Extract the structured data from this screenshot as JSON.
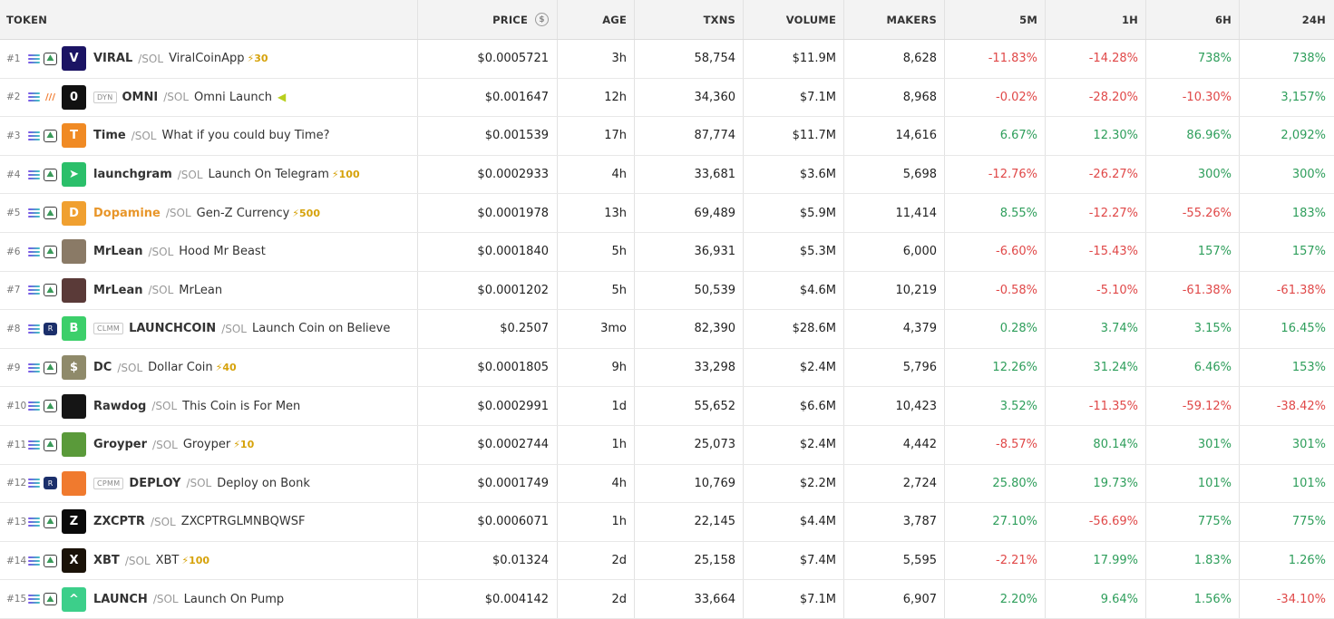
{
  "headers": {
    "token": "TOKEN",
    "price": "PRICE",
    "age": "AGE",
    "txns": "TXNS",
    "volume": "VOLUME",
    "makers": "MAKERS",
    "m5": "5M",
    "h1": "1H",
    "h6": "6H",
    "h24": "24H"
  },
  "price_icon": "$",
  "colors": {
    "positive": "#2e9e5b",
    "negative": "#e04848",
    "boost": "#d6a20a",
    "dopamine": "#f0a030"
  },
  "rows": [
    {
      "rank": "#1",
      "dex": "pump",
      "logo_icon": "viral-v-icon",
      "logo_color": "#1b1464",
      "logo_glyph": "V",
      "badge": "",
      "symbol": "VIRAL",
      "quote": "/SOL",
      "name": "ViralCoinApp",
      "boost": "⚡30",
      "flag": false,
      "price": "$0.0005721",
      "age": "3h",
      "txns": "58,754",
      "volume": "$11.9M",
      "makers": "8,628",
      "m5": "-11.83%",
      "h1": "-14.28%",
      "h6": "738%",
      "h24": "738%"
    },
    {
      "rank": "#2",
      "dex": "orange",
      "logo_icon": "omni-zero-icon",
      "logo_color": "#111111",
      "logo_glyph": "0",
      "badge": "DYN",
      "symbol": "OMNI",
      "quote": "/SOL",
      "name": "Omni Launch",
      "boost": "",
      "flag": true,
      "price": "$0.001647",
      "age": "12h",
      "txns": "34,360",
      "volume": "$7.1M",
      "makers": "8,968",
      "m5": "-0.02%",
      "h1": "-28.20%",
      "h6": "-10.30%",
      "h24": "3,157%"
    },
    {
      "rank": "#3",
      "dex": "pump",
      "logo_icon": "time-coin-icon",
      "logo_color": "#f08a24",
      "logo_glyph": "T",
      "badge": "",
      "symbol": "Time",
      "quote": "/SOL",
      "name": "What if you could buy Time?",
      "boost": "",
      "flag": false,
      "price": "$0.001539",
      "age": "17h",
      "txns": "87,774",
      "volume": "$11.7M",
      "makers": "14,616",
      "m5": "6.67%",
      "h1": "12.30%",
      "h6": "86.96%",
      "h24": "2,092%"
    },
    {
      "rank": "#4",
      "dex": "pump",
      "logo_icon": "telegram-icon",
      "logo_color": "#2bbf6a",
      "logo_glyph": "➤",
      "badge": "",
      "symbol": "launchgram",
      "quote": "/SOL",
      "name": "Launch On Telegram",
      "boost": "⚡100",
      "flag": false,
      "price": "$0.0002933",
      "age": "4h",
      "txns": "33,681",
      "volume": "$3.6M",
      "makers": "5,698",
      "m5": "-12.76%",
      "h1": "-26.27%",
      "h6": "300%",
      "h24": "300%"
    },
    {
      "rank": "#5",
      "dex": "pump",
      "logo_icon": "dopamine-logo-icon",
      "logo_color": "#f0a030",
      "logo_glyph": "D",
      "badge": "",
      "symbol": "Dopamine",
      "quote": "/SOL",
      "name": "Gen-Z Currency",
      "boost": "⚡500",
      "flag": false,
      "price": "$0.0001978",
      "age": "13h",
      "txns": "69,489",
      "volume": "$5.9M",
      "makers": "11,414",
      "m5": "8.55%",
      "h1": "-12.27%",
      "h6": "-55.26%",
      "h24": "183%",
      "symbol_color": "#e8962a"
    },
    {
      "rank": "#6",
      "dex": "pump",
      "logo_icon": "mrlean-photo-icon",
      "logo_color": "#8a7a66",
      "logo_glyph": "",
      "badge": "",
      "symbol": "MrLean",
      "quote": "/SOL",
      "name": "Hood Mr Beast",
      "boost": "",
      "flag": false,
      "price": "$0.0001840",
      "age": "5h",
      "txns": "36,931",
      "volume": "$5.3M",
      "makers": "6,000",
      "m5": "-6.60%",
      "h1": "-15.43%",
      "h6": "157%",
      "h24": "157%"
    },
    {
      "rank": "#7",
      "dex": "pump",
      "logo_icon": "mrlean-photo-icon",
      "logo_color": "#5a3a38",
      "logo_glyph": "",
      "badge": "",
      "symbol": "MrLean",
      "quote": "/SOL",
      "name": "MrLean",
      "boost": "",
      "flag": false,
      "price": "$0.0001202",
      "age": "5h",
      "txns": "50,539",
      "volume": "$4.6M",
      "makers": "10,219",
      "m5": "-0.58%",
      "h1": "-5.10%",
      "h6": "-61.38%",
      "h24": "-61.38%"
    },
    {
      "rank": "#8",
      "dex": "ray",
      "logo_icon": "believe-b-icon",
      "logo_color": "#3ccf6a",
      "logo_glyph": "B",
      "badge": "CLMM",
      "symbol": "LAUNCHCOIN",
      "quote": "/SOL",
      "name": "Launch Coin on Believe",
      "boost": "",
      "flag": false,
      "price": "$0.2507",
      "age": "3mo",
      "txns": "82,390",
      "volume": "$28.6M",
      "makers": "4,379",
      "m5": "0.28%",
      "h1": "3.74%",
      "h6": "3.15%",
      "h24": "16.45%"
    },
    {
      "rank": "#9",
      "dex": "pump",
      "logo_icon": "dollar-coin-icon",
      "logo_color": "#8f8a6a",
      "logo_glyph": "$",
      "badge": "",
      "symbol": "DC",
      "quote": "/SOL",
      "name": "Dollar Coin",
      "boost": "⚡40",
      "flag": false,
      "price": "$0.0001805",
      "age": "9h",
      "txns": "33,298",
      "volume": "$2.4M",
      "makers": "5,796",
      "m5": "12.26%",
      "h1": "31.24%",
      "h6": "6.46%",
      "h24": "153%"
    },
    {
      "rank": "#10",
      "dex": "pump",
      "logo_icon": "rawdog-icon",
      "logo_color": "#151515",
      "logo_glyph": "",
      "badge": "",
      "symbol": "Rawdog",
      "quote": "/SOL",
      "name": "This Coin is For Men",
      "boost": "",
      "flag": false,
      "price": "$0.0002991",
      "age": "1d",
      "txns": "55,652",
      "volume": "$6.6M",
      "makers": "10,423",
      "m5": "3.52%",
      "h1": "-11.35%",
      "h6": "-59.12%",
      "h24": "-38.42%"
    },
    {
      "rank": "#11",
      "dex": "pump",
      "logo_icon": "frog-icon",
      "logo_color": "#5a9a3a",
      "logo_glyph": "",
      "badge": "",
      "symbol": "Groyper",
      "quote": "/SOL",
      "name": "Groyper",
      "boost": "⚡10",
      "flag": false,
      "price": "$0.0002744",
      "age": "1h",
      "txns": "25,073",
      "volume": "$2.4M",
      "makers": "4,442",
      "m5": "-8.57%",
      "h1": "80.14%",
      "h6": "301%",
      "h24": "301%"
    },
    {
      "rank": "#12",
      "dex": "ray",
      "logo_icon": "bonk-dog-icon",
      "logo_color": "#f07a2e",
      "logo_glyph": "",
      "badge": "CPMM",
      "symbol": "DEPLOY",
      "quote": "/SOL",
      "name": "Deploy on Bonk",
      "boost": "",
      "flag": false,
      "price": "$0.0001749",
      "age": "4h",
      "txns": "10,769",
      "volume": "$2.2M",
      "makers": "2,724",
      "m5": "25.80%",
      "h1": "19.73%",
      "h6": "101%",
      "h24": "101%"
    },
    {
      "rank": "#13",
      "dex": "pump",
      "logo_icon": "zxcptr-icon",
      "logo_color": "#0a0a0a",
      "logo_glyph": "Z",
      "badge": "",
      "symbol": "ZXCPTR",
      "quote": "/SOL",
      "name": "ZXCPTRGLMNBQWSF",
      "boost": "",
      "flag": false,
      "price": "$0.0006071",
      "age": "1h",
      "txns": "22,145",
      "volume": "$4.4M",
      "makers": "3,787",
      "m5": "27.10%",
      "h1": "-56.69%",
      "h6": "775%",
      "h24": "775%"
    },
    {
      "rank": "#14",
      "dex": "pump",
      "logo_icon": "xbt-icon",
      "logo_color": "#1a1208",
      "logo_glyph": "X",
      "badge": "",
      "symbol": "XBT",
      "quote": "/SOL",
      "name": "XBT",
      "boost": "⚡100",
      "flag": false,
      "price": "$0.01324",
      "age": "2d",
      "txns": "25,158",
      "volume": "$7.4M",
      "makers": "5,595",
      "m5": "-2.21%",
      "h1": "17.99%",
      "h6": "1.83%",
      "h24": "1.26%"
    },
    {
      "rank": "#15",
      "dex": "pump",
      "logo_icon": "launch-chevron-icon",
      "logo_color": "#3ccf8a",
      "logo_glyph": "^",
      "badge": "",
      "symbol": "LAUNCH",
      "quote": "/SOL",
      "name": "Launch On Pump",
      "boost": "",
      "flag": false,
      "price": "$0.004142",
      "age": "2d",
      "txns": "33,664",
      "volume": "$7.1M",
      "makers": "6,907",
      "m5": "2.20%",
      "h1": "9.64%",
      "h6": "1.56%",
      "h24": "-34.10%"
    }
  ]
}
